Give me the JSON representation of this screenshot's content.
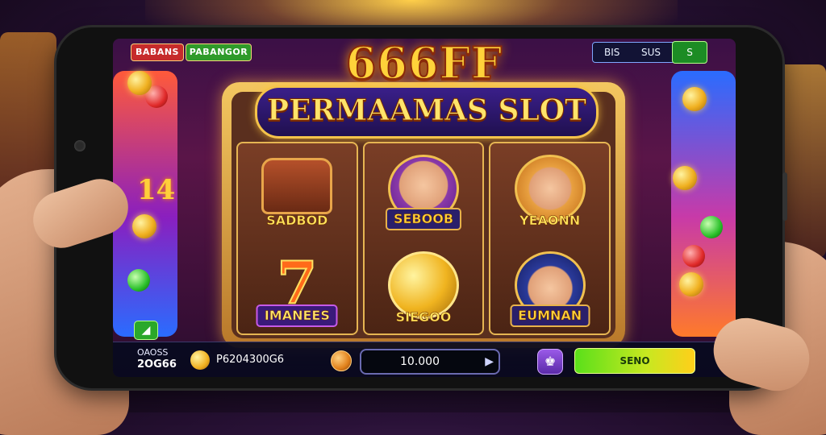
{
  "game": {
    "title": "666FF",
    "subtitle": "PERMAAMAS SLOT"
  },
  "topbar": {
    "red_pill": "BABANS",
    "green_pill": "PABANGOR",
    "info_a": "BIS",
    "info_b": "SUS",
    "info_btn": "S"
  },
  "side": {
    "left_number": "14"
  },
  "reels": [
    {
      "top": {
        "symbol": "chest-icon",
        "label": "SADBOD"
      },
      "bottom": {
        "symbol": "seven-icon",
        "glyph": "7",
        "label": "IMANEES"
      }
    },
    {
      "top": {
        "symbol": "captain-face-icon",
        "label": "SEBOOB"
      },
      "bottom": {
        "symbol": "treasure-coin-icon",
        "label": "SIEGOO"
      }
    },
    {
      "top": {
        "symbol": "blonde-face-icon",
        "label": "YEAONN"
      },
      "bottom": {
        "symbol": "police-face-icon",
        "label": "EUMNAN"
      }
    }
  ],
  "bottombar": {
    "bet_label": "OAOSS",
    "bet_value": "2OG66",
    "balance": "P6204300G6",
    "amount": "10.000",
    "play_arrow": "▶",
    "util_icon": "♚",
    "spin_label": "SENO",
    "chip_icon": "◢"
  },
  "colors": {
    "title": "#ffd23a",
    "banner": "#3a1f8a",
    "frame": "#f3c760",
    "spin": "#5ae01a"
  }
}
